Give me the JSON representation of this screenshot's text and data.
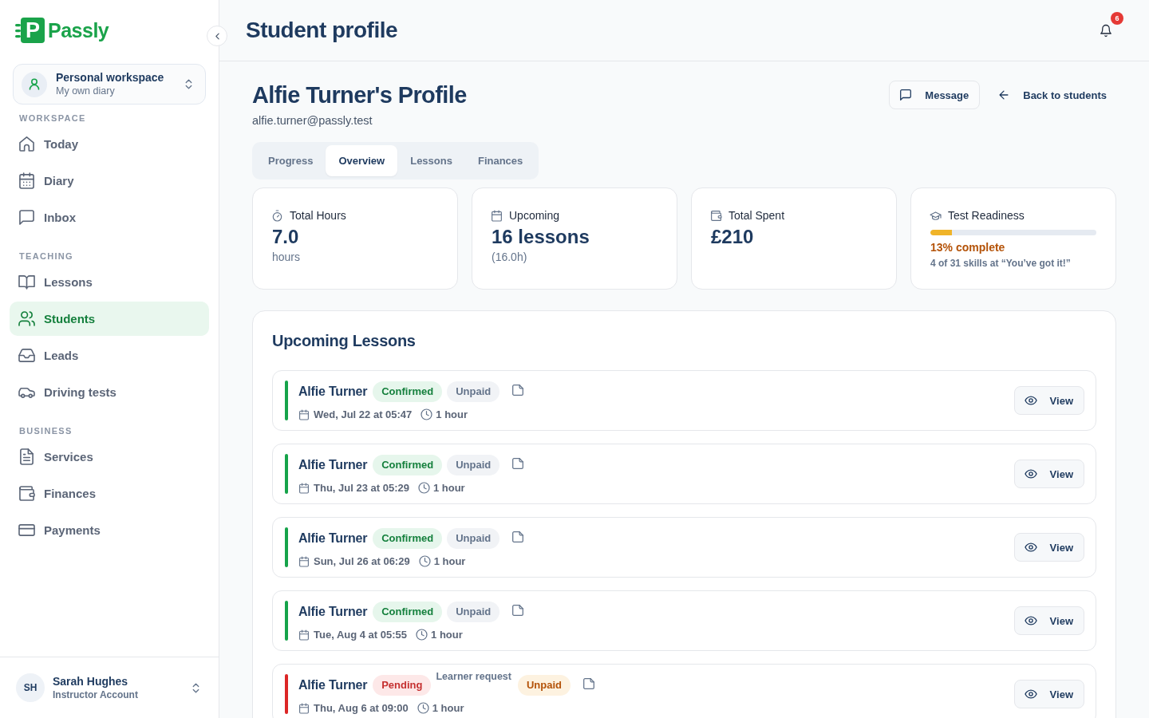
{
  "sidebar": {
    "logo": {
      "mark": "P",
      "name": "Passly"
    },
    "workspace": {
      "title": "Personal workspace",
      "subtitle": "My own diary"
    },
    "sections": [
      {
        "heading": "WORKSPACE",
        "items": [
          {
            "label": "Today",
            "selected": false
          },
          {
            "label": "Diary",
            "selected": false
          },
          {
            "label": "Inbox",
            "selected": false
          }
        ]
      },
      {
        "heading": "TEACHING",
        "items": [
          {
            "label": "Lessons",
            "selected": false
          },
          {
            "label": "Students",
            "selected": true
          },
          {
            "label": "Leads",
            "selected": false
          },
          {
            "label": "Driving tests",
            "selected": false
          }
        ]
      },
      {
        "heading": "BUSINESS",
        "items": [
          {
            "label": "Services",
            "selected": false
          },
          {
            "label": "Finances",
            "selected": false
          },
          {
            "label": "Payments",
            "selected": false
          }
        ]
      }
    ],
    "user": {
      "initials": "SH",
      "name": "Sarah Hughes",
      "role": "Instructor Account"
    }
  },
  "header": {
    "title": "Student profile",
    "notifications": "6"
  },
  "profile": {
    "name": "Alfie Turner's Profile",
    "email": "alfie.turner@passly.test",
    "actions": [
      {
        "label": "Message",
        "kind": "outlined"
      },
      {
        "label": "Back to students",
        "kind": "plain"
      }
    ]
  },
  "tabs": [
    {
      "label": "Progress",
      "selected": false
    },
    {
      "label": "Overview",
      "selected": true
    },
    {
      "label": "Lessons",
      "selected": false
    },
    {
      "label": "Finances",
      "selected": false
    }
  ],
  "stats": [
    {
      "kind": "stat",
      "label": "Total Hours",
      "value": "7.0",
      "note": "hours"
    },
    {
      "kind": "stat",
      "label": "Upcoming",
      "value": "16 lessons",
      "note": "(16.0h)"
    },
    {
      "kind": "stat",
      "label": "Total Spent",
      "value": "£210"
    },
    {
      "kind": "progress",
      "label": "Test Readiness",
      "level": 0.13,
      "value": "13% complete",
      "note": "4 of 31 skills at “You’ve got it!”"
    }
  ],
  "upcoming_lessons": {
    "title": "Upcoming Lessons",
    "lessons": [
      {
        "student": "Alfie Turner",
        "status": {
          "label": "Confirmed",
          "kind": "confirmed"
        },
        "payment": {
          "label": "Unpaid",
          "kind": "neutral"
        },
        "date": "Wed, Jul 22 at 05:47",
        "duration": "1 hour",
        "action": "View"
      },
      {
        "student": "Alfie Turner",
        "status": {
          "label": "Confirmed",
          "kind": "confirmed"
        },
        "payment": {
          "label": "Unpaid",
          "kind": "neutral"
        },
        "date": "Thu, Jul 23 at 05:29",
        "duration": "1 hour",
        "action": "View"
      },
      {
        "student": "Alfie Turner",
        "status": {
          "label": "Confirmed",
          "kind": "confirmed"
        },
        "payment": {
          "label": "Unpaid",
          "kind": "neutral"
        },
        "date": "Sun, Jul 26 at 06:29",
        "duration": "1 hour",
        "action": "View"
      },
      {
        "student": "Alfie Turner",
        "status": {
          "label": "Confirmed",
          "kind": "confirmed"
        },
        "payment": {
          "label": "Unpaid",
          "kind": "neutral"
        },
        "date": "Tue, Aug 4 at 05:55",
        "duration": "1 hour",
        "action": "View"
      },
      {
        "student": "Alfie Turner",
        "status": {
          "label": "Pending",
          "kind": "pending"
        },
        "request": "Learner request",
        "payment": {
          "label": "Unpaid",
          "kind": "warning"
        },
        "date": "Thu, Aug 6 at 09:00",
        "duration": "1 hour",
        "action": "View"
      }
    ]
  }
}
